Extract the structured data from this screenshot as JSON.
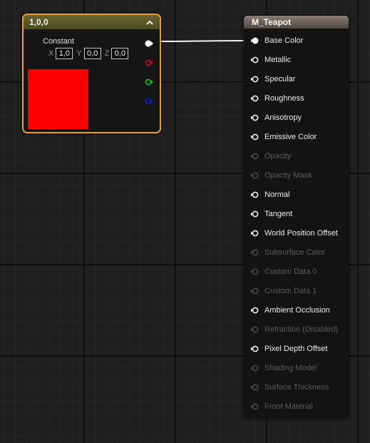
{
  "constant_node": {
    "title": "1,0,0",
    "label": "Constant",
    "x_label": "X",
    "x_value": "1,0",
    "y_label": "Y",
    "y_value": "0,0",
    "z_label": "Z",
    "z_value": "0,0",
    "swatch_color": "#ff0000",
    "outputs": [
      "white-pin",
      "red-pin",
      "green-pin",
      "blue-pin"
    ]
  },
  "material_node": {
    "title": "M_Teapot",
    "inputs": [
      {
        "label": "Base Color",
        "enabled": true,
        "connected": true
      },
      {
        "label": "Metallic",
        "enabled": true
      },
      {
        "label": "Specular",
        "enabled": true
      },
      {
        "label": "Roughness",
        "enabled": true
      },
      {
        "label": "Anisotropy",
        "enabled": true
      },
      {
        "label": "Emissive Color",
        "enabled": true
      },
      {
        "label": "Opacity",
        "enabled": false
      },
      {
        "label": "Opacity Mask",
        "enabled": false
      },
      {
        "label": "Normal",
        "enabled": true
      },
      {
        "label": "Tangent",
        "enabled": true
      },
      {
        "label": "World Position Offset",
        "enabled": true
      },
      {
        "label": "Subsurface Color",
        "enabled": false
      },
      {
        "label": "Custom Data 0",
        "enabled": false
      },
      {
        "label": "Custom Data 1",
        "enabled": false
      },
      {
        "label": "Ambient Occlusion",
        "enabled": true
      },
      {
        "label": "Refraction (Disabled)",
        "enabled": false
      },
      {
        "label": "Pixel Depth Offset",
        "enabled": true
      },
      {
        "label": "Shading Model",
        "enabled": false
      },
      {
        "label": "Surface Thickness",
        "enabled": false
      },
      {
        "label": "Front Material",
        "enabled": false
      }
    ]
  },
  "colors": {
    "selection_border": "#f0a020",
    "wire": "#ffffff",
    "disabled_text": "#5b5b5b"
  }
}
